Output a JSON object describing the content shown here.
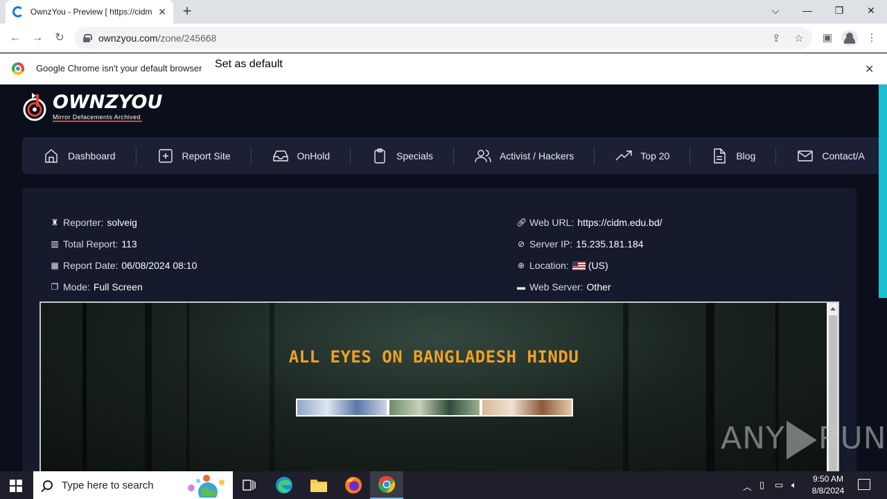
{
  "browser": {
    "tab_title": "OwnzYou - Preview [ https://cidm.edu.bd/ ]",
    "url_host": "ownzyou.com",
    "url_path": "/zone/245668",
    "infobar_message": "Google Chrome isn't your default browser",
    "set_default_label": "Set as default"
  },
  "site": {
    "logo_text": "OWNZYOU",
    "logo_tagline": "Mirror Defacements Archived",
    "nav": [
      {
        "label": "Dashboard",
        "icon": "home-icon"
      },
      {
        "label": "Report Site",
        "icon": "plus-square-icon"
      },
      {
        "label": "OnHold",
        "icon": "inbox-icon"
      },
      {
        "label": "Specials",
        "icon": "clipboard-icon"
      },
      {
        "label": "Activist / Hackers",
        "icon": "users-icon"
      },
      {
        "label": "Top 20",
        "icon": "trending-up-icon"
      },
      {
        "label": "Blog",
        "icon": "file-text-icon"
      },
      {
        "label": "Contact/A",
        "icon": "mail-icon"
      }
    ],
    "details_left": [
      {
        "label": "Reporter:",
        "value": "solveig",
        "icon": "user-secret-icon"
      },
      {
        "label": "Total Report:",
        "value": "113",
        "icon": "bar-chart-icon"
      },
      {
        "label": "Report Date:",
        "value": "06/08/2024 08:10",
        "icon": "calendar-icon"
      },
      {
        "label": "Mode:",
        "value": "Full Screen",
        "icon": "window-restore-icon"
      }
    ],
    "details_right": [
      {
        "label": "Web URL:",
        "value": "https://cidm.edu.bd/",
        "icon": "link-icon"
      },
      {
        "label": "Server IP:",
        "value": "15.235.181.184",
        "icon": "paperclip-icon"
      },
      {
        "label": "Location:",
        "value": "(US)",
        "icon": "globe-icon"
      },
      {
        "label": "Web Server:",
        "value": "Other",
        "icon": "server-icon"
      }
    ],
    "preview_headline": "ALL EYES ON BANGLADESH HINDU"
  },
  "watermark": "ANY RUN",
  "taskbar": {
    "search_placeholder": "Type here to search",
    "time": "9:50 AM",
    "date": "8/8/2024"
  },
  "colors": {
    "accent_scroll": "#17c1cf",
    "site_bg": "#0b0f1c",
    "headline": "#f0a127",
    "chrome_button": "#1a73e8"
  }
}
